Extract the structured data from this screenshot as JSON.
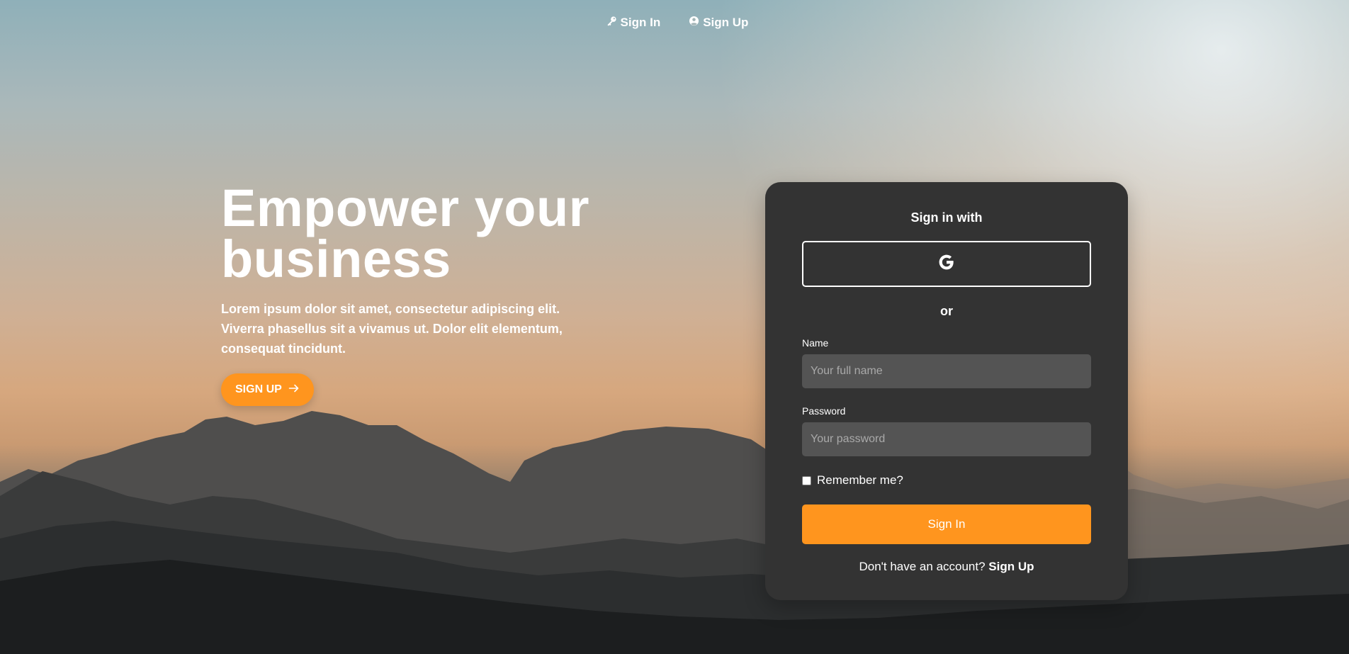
{
  "nav": {
    "signin_label": "Sign In",
    "signup_label": "Sign Up",
    "signin_icon": "key-icon",
    "signup_icon": "user-circle-icon"
  },
  "hero": {
    "title_line1": "Empower your",
    "title_line2": "business",
    "description": "Lorem ipsum dolor sit amet, consectetur adipiscing elit. Viverra phasellus sit a vivamus ut. Dolor elit elementum, consequat tincidunt.",
    "cta_label": "SIGN UP",
    "cta_icon": "arrow-right-icon"
  },
  "card": {
    "title": "Sign in with",
    "google_icon": "google-icon",
    "separator": "or",
    "name_label": "Name",
    "name_placeholder": "Your full name",
    "name_value": "",
    "password_label": "Password",
    "password_placeholder": "Your password",
    "password_value": "",
    "remember_label": "Remember me?",
    "remember_checked": false,
    "submit_label": "Sign In",
    "footer_text": "Don't have an account?",
    "footer_link": "Sign Up"
  },
  "colors": {
    "accent": "#ff951e",
    "card_bg": "#333333",
    "input_bg": "#545454",
    "text": "#ffffff"
  }
}
